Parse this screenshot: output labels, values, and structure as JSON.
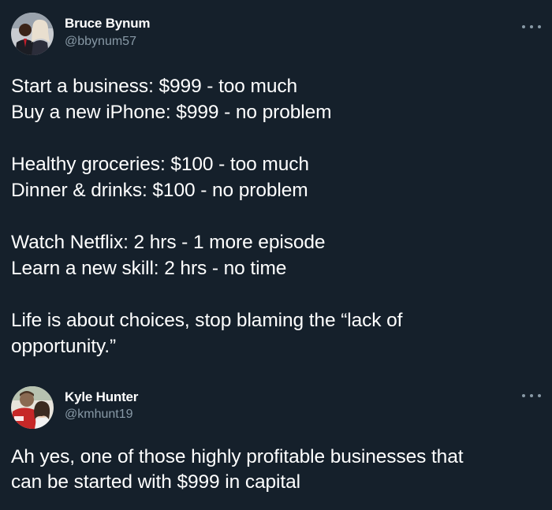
{
  "tweets": [
    {
      "author": {
        "display_name": "Bruce Bynum",
        "handle": "@bbynum57"
      },
      "paragraphs": [
        [
          "Start a business: $999 - too much",
          "Buy a new iPhone: $999 - no problem"
        ],
        [
          "Healthy groceries: $100 - too much",
          "Dinner & drinks: $100 - no problem"
        ],
        [
          "Watch Netflix: 2 hrs - 1 more episode",
          "Learn a new skill: 2 hrs - no time"
        ],
        [
          "Life is about choices, stop blaming the “lack of",
          "opportunity.”"
        ]
      ]
    },
    {
      "author": {
        "display_name": "Kyle Hunter",
        "handle": "@kmhunt19"
      },
      "paragraphs": [
        [
          "Ah yes, one of those highly profitable businesses that",
          "can be started with $999 in capital"
        ]
      ]
    }
  ],
  "icons": {
    "more": "more-horizontal-icon",
    "avatar": "profile-photo"
  },
  "colors": {
    "background": "#15202b",
    "text": "#ffffff",
    "secondary_text": "#8899a6"
  }
}
